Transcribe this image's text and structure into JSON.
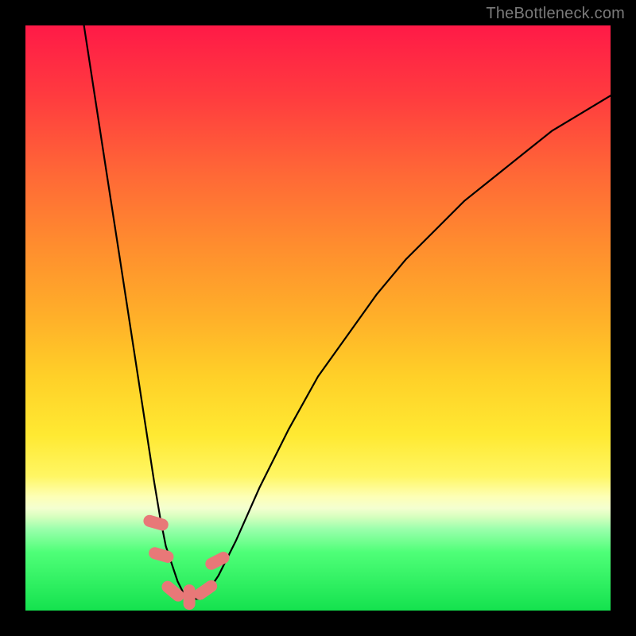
{
  "watermark": "TheBottleneck.com",
  "chart_data": {
    "type": "line",
    "title": "",
    "xlabel": "",
    "ylabel": "",
    "xlim": [
      0,
      100
    ],
    "ylim": [
      0,
      100
    ],
    "series": [
      {
        "name": "curve",
        "x": [
          10,
          12,
          14,
          16,
          18,
          20,
          22,
          23,
          24,
          25,
          26,
          27,
          28,
          29,
          30,
          31,
          33,
          36,
          40,
          45,
          50,
          55,
          60,
          65,
          70,
          75,
          80,
          85,
          90,
          95,
          100
        ],
        "values": [
          100,
          87,
          74,
          61,
          48,
          35,
          22,
          16,
          11,
          8,
          5,
          3,
          2,
          2,
          2,
          3,
          6,
          12,
          21,
          31,
          40,
          47,
          54,
          60,
          65,
          70,
          74,
          78,
          82,
          85,
          88
        ]
      }
    ],
    "markers": [
      {
        "x": 22.3,
        "y": 15.0,
        "angle": -74
      },
      {
        "x": 23.2,
        "y": 9.5,
        "angle": -74
      },
      {
        "x": 25.2,
        "y": 3.3,
        "angle": -50
      },
      {
        "x": 28.0,
        "y": 2.3,
        "angle": 0
      },
      {
        "x": 30.8,
        "y": 3.5,
        "angle": 55
      },
      {
        "x": 32.8,
        "y": 8.5,
        "angle": 63
      }
    ],
    "colors": {
      "curve": "#000000",
      "marker": "#e87878"
    }
  }
}
